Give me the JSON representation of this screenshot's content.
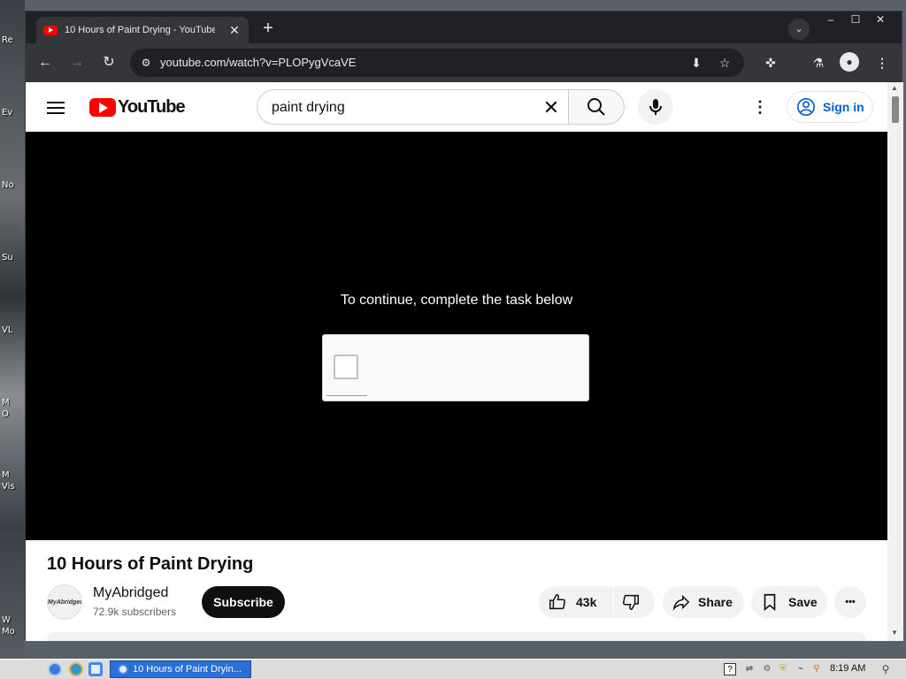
{
  "desktop": {
    "labels": [
      "Re",
      "Ev",
      "No",
      "Su",
      "VL",
      "M",
      "O",
      "M",
      "Vis",
      "W",
      "Mo"
    ]
  },
  "browser": {
    "tab_title": "10 Hours of Paint Drying - YouTube",
    "tab_close": "✕",
    "new_tab": "+",
    "url": "youtube.com/watch?v=PLOPygVcaVE",
    "window_controls": {
      "minimize": "–",
      "maximize": "☐",
      "close": "✕"
    }
  },
  "youtube": {
    "logo_text": "YouTube",
    "search_value": "paint drying",
    "search_clear": "✕",
    "sign_in": "Sign in"
  },
  "player": {
    "captcha_message": "To continue, complete the task below"
  },
  "video": {
    "title": "10 Hours of Paint Drying",
    "channel_name": "MyAbridged",
    "channel_avatar_text": "MyAbridged",
    "subscribers": "72.9k subscribers",
    "subscribe_label": "Subscribe",
    "like_count": "43k",
    "share_label": "Share",
    "save_label": "Save",
    "more_label": "•••"
  },
  "taskbar": {
    "task_label": "10 Hours of Paint Dryin...",
    "clock": "8:19 AM"
  },
  "colors": {
    "youtube_red": "#ff0000",
    "signin_blue": "#065fd4",
    "taskbar_active": "#2a6fd6"
  }
}
